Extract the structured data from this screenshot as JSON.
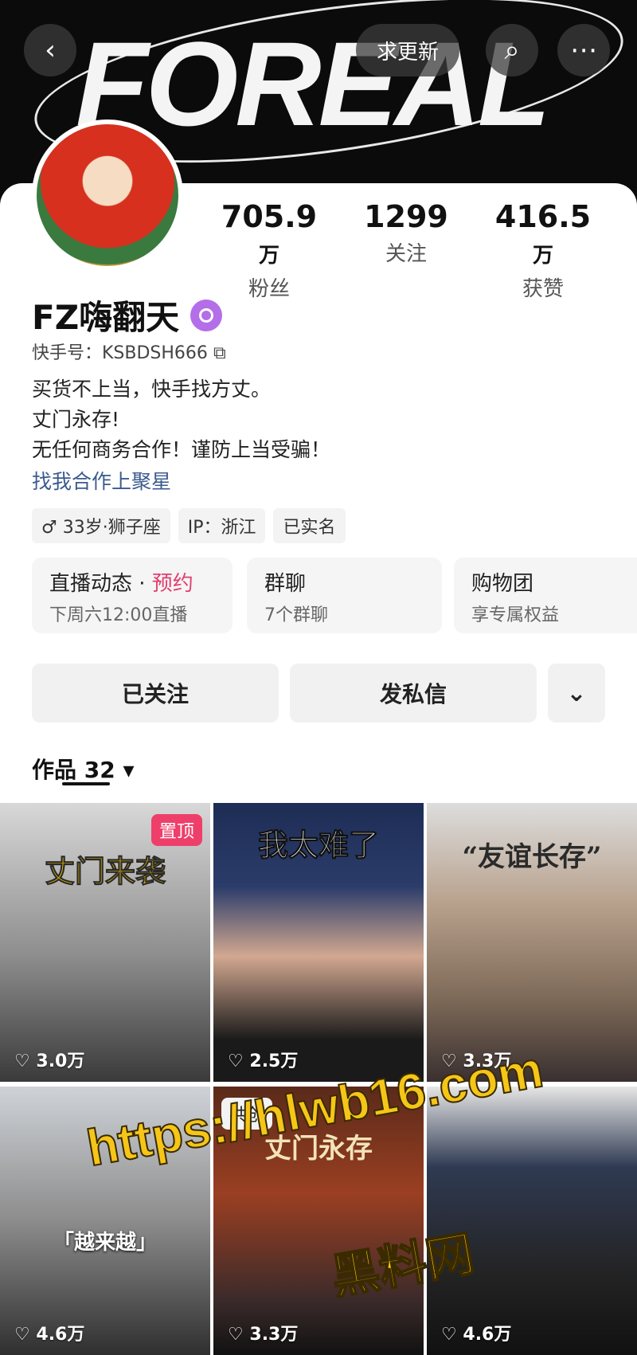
{
  "banner": {
    "title": "FOREAL"
  },
  "topbar": {
    "back_icon": "‹",
    "update_label": "求更新",
    "search_icon": "⌕",
    "more_icon": "⋯"
  },
  "stats": [
    {
      "num": "705.9",
      "unit": "万",
      "label": "粉丝"
    },
    {
      "num": "1299",
      "unit": "",
      "label": "关注"
    },
    {
      "num": "416.5",
      "unit": "万",
      "label": "获赞"
    }
  ],
  "profile": {
    "name": "FZ嗨翻天",
    "kuaishou_id": "快手号：KSBDSH666",
    "bio": [
      "买货不上当，快手找方丈。",
      "丈门永存!",
      "无任何商务合作！谨防上当受骗！"
    ],
    "link": "找我合作上聚星",
    "tags": [
      "♂ 33岁·狮子座",
      "IP：浙江",
      "已实名"
    ]
  },
  "features": [
    {
      "title": "直播动态 · ",
      "title_accent": "预约",
      "sub": "下周六12:00直播"
    },
    {
      "title": "群聊",
      "sub": "7个群聊"
    },
    {
      "title": "购物团",
      "sub": "享专属权益"
    }
  ],
  "actions": {
    "follow": "已关注",
    "message": "发私信",
    "more": "⌄"
  },
  "works": {
    "label": "作品 32 ▾"
  },
  "videos": [
    {
      "caption": "丈门来袭",
      "badge": "置顶",
      "likes": "♡ 3.0万"
    },
    {
      "caption": "我太难了",
      "likes": "♡ 2.5万"
    },
    {
      "caption": "“友谊长存”",
      "likes": "♡ 3.3万"
    },
    {
      "caption": "「越来越」",
      "likes": "♡ 4.6万"
    },
    {
      "caption": "丈门永存",
      "badge": "共创",
      "likes": "♡ 3.3万"
    },
    {
      "caption": "",
      "likes": "♡ 4.6万"
    }
  ],
  "watermark": {
    "url": "https://hlwb16.com",
    "name": "黑料网"
  }
}
